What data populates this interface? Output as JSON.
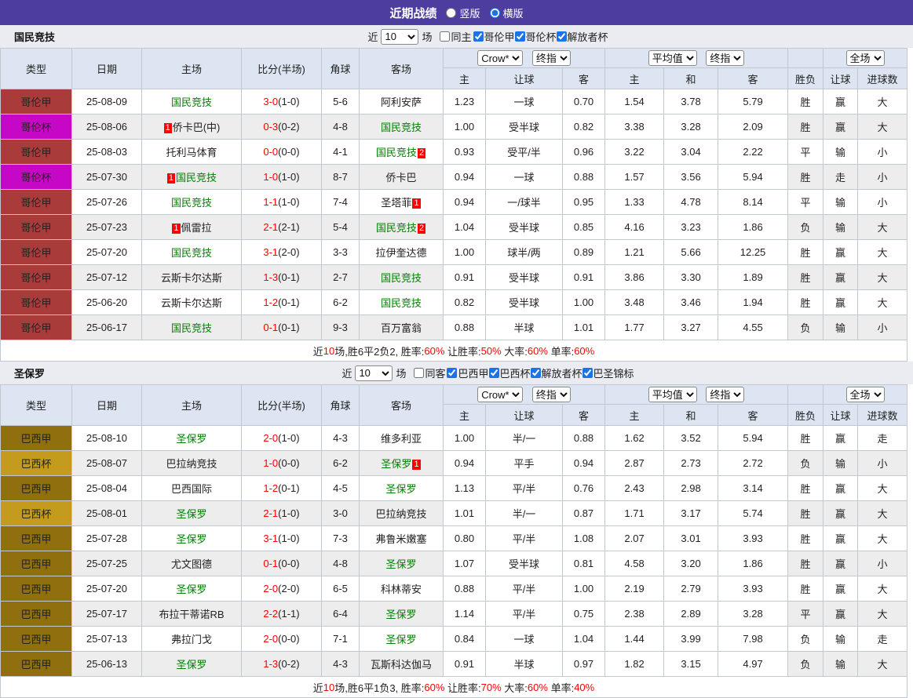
{
  "topbar": {
    "title": "近期战绩",
    "layout_options": [
      {
        "label": "竖版",
        "checked": false
      },
      {
        "label": "横版",
        "checked": true
      }
    ]
  },
  "league_colors": {
    "哥伦甲": "#A93B3B",
    "哥伦杯": "#C607C6",
    "巴西甲": "#8F6F0E",
    "巴西杯": "#C49B1D"
  },
  "result_colors": {
    "r": "#FF0000",
    "g": "#008000",
    "b": "#0011CC"
  },
  "table_headers": {
    "left": [
      "类型",
      "日期",
      "主场",
      "比分(半场)",
      "角球",
      "客场"
    ],
    "odds_sub": [
      "主",
      "让球",
      "客"
    ],
    "avg_sub": [
      "主",
      "和",
      "客"
    ],
    "right_sub": [
      "胜负",
      "让球",
      "进球数"
    ]
  },
  "sections": [
    {
      "team": "国民竞技",
      "filter": {
        "prefix": "近",
        "count": "10",
        "suffix": "场",
        "same": {
          "label": "同主",
          "checked": false
        },
        "leagues": [
          {
            "label": "哥伦甲",
            "checked": true
          },
          {
            "label": "哥伦杯",
            "checked": true
          },
          {
            "label": "解放者杯",
            "checked": true
          }
        ]
      },
      "selects": {
        "company": "Crow*",
        "final1": "终指",
        "average": "平均值",
        "final2": "终指",
        "scope": "全场"
      },
      "rows": [
        {
          "league": "哥伦甲",
          "date": "25-08-09",
          "home": {
            "name": "国民竞技",
            "focus": true
          },
          "score": "3-0",
          "half": "(1-0)",
          "corners": "5-6",
          "away": {
            "name": "阿利安萨"
          },
          "odds": [
            "1.23",
            "一球",
            "0.70"
          ],
          "avg": [
            "1.54",
            "3.78",
            "5.79"
          ],
          "results": [
            [
              "胜",
              "r"
            ],
            [
              "赢",
              "r"
            ],
            [
              "大",
              "r"
            ]
          ]
        },
        {
          "league": "哥伦杯",
          "date": "25-08-06",
          "home": {
            "badge_before": "1",
            "name": "侨卡巴(中)"
          },
          "score": "0-3",
          "half": "(0-2)",
          "corners": "4-8",
          "away": {
            "name": "国民竞技",
            "focus": true
          },
          "odds": [
            "1.00",
            "受半球",
            "0.82"
          ],
          "avg": [
            "3.38",
            "3.28",
            "2.09"
          ],
          "results": [
            [
              "胜",
              "r"
            ],
            [
              "赢",
              "r"
            ],
            [
              "大",
              "r"
            ]
          ]
        },
        {
          "league": "哥伦甲",
          "date": "25-08-03",
          "home": {
            "name": "托利马体育"
          },
          "score": "0-0",
          "half": "(0-0)",
          "corners": "4-1",
          "away": {
            "name": "国民竞技",
            "focus": true,
            "badge_after": "2"
          },
          "odds": [
            "0.93",
            "受平/半",
            "0.96"
          ],
          "avg": [
            "3.22",
            "3.04",
            "2.22"
          ],
          "results": [
            [
              "平",
              "g"
            ],
            [
              "输",
              "b"
            ],
            [
              "小",
              "b"
            ]
          ]
        },
        {
          "league": "哥伦杯",
          "date": "25-07-30",
          "home": {
            "badge_before": "1",
            "name": "国民竞技",
            "focus": true
          },
          "score": "1-0",
          "half": "(1-0)",
          "corners": "8-7",
          "away": {
            "name": "侨卡巴"
          },
          "odds": [
            "0.94",
            "一球",
            "0.88"
          ],
          "avg": [
            "1.57",
            "3.56",
            "5.94"
          ],
          "results": [
            [
              "胜",
              "r"
            ],
            [
              "走",
              "g"
            ],
            [
              "小",
              "b"
            ]
          ]
        },
        {
          "league": "哥伦甲",
          "date": "25-07-26",
          "home": {
            "name": "国民竞技",
            "focus": true
          },
          "score": "1-1",
          "half": "(1-0)",
          "corners": "7-4",
          "away": {
            "name": "圣塔菲",
            "badge_after": "1"
          },
          "odds": [
            "0.94",
            "一/球半",
            "0.95"
          ],
          "avg": [
            "1.33",
            "4.78",
            "8.14"
          ],
          "results": [
            [
              "平",
              "g"
            ],
            [
              "输",
              "b"
            ],
            [
              "小",
              "b"
            ]
          ]
        },
        {
          "league": "哥伦甲",
          "date": "25-07-23",
          "home": {
            "badge_before": "1",
            "name": "佩雷拉"
          },
          "score": "2-1",
          "half": "(2-1)",
          "corners": "5-4",
          "away": {
            "name": "国民竞技",
            "focus": true,
            "badge_after": "2"
          },
          "odds": [
            "1.04",
            "受半球",
            "0.85"
          ],
          "avg": [
            "4.16",
            "3.23",
            "1.86"
          ],
          "results": [
            [
              "负",
              "b"
            ],
            [
              "输",
              "b"
            ],
            [
              "大",
              "r"
            ]
          ]
        },
        {
          "league": "哥伦甲",
          "date": "25-07-20",
          "home": {
            "name": "国民竞技",
            "focus": true
          },
          "score": "3-1",
          "half": "(2-0)",
          "corners": "3-3",
          "away": {
            "name": "拉伊奎达德"
          },
          "odds": [
            "1.00",
            "球半/两",
            "0.89"
          ],
          "avg": [
            "1.21",
            "5.66",
            "12.25"
          ],
          "results": [
            [
              "胜",
              "r"
            ],
            [
              "赢",
              "r"
            ],
            [
              "大",
              "r"
            ]
          ]
        },
        {
          "league": "哥伦甲",
          "date": "25-07-12",
          "home": {
            "name": "云斯卡尔达斯"
          },
          "score": "1-3",
          "half": "(0-1)",
          "corners": "2-7",
          "away": {
            "name": "国民竞技",
            "focus": true
          },
          "odds": [
            "0.91",
            "受半球",
            "0.91"
          ],
          "avg": [
            "3.86",
            "3.30",
            "1.89"
          ],
          "results": [
            [
              "胜",
              "r"
            ],
            [
              "赢",
              "r"
            ],
            [
              "大",
              "r"
            ]
          ]
        },
        {
          "league": "哥伦甲",
          "date": "25-06-20",
          "home": {
            "name": "云斯卡尔达斯"
          },
          "score": "1-2",
          "half": "(0-1)",
          "corners": "6-2",
          "away": {
            "name": "国民竞技",
            "focus": true
          },
          "odds": [
            "0.82",
            "受半球",
            "1.00"
          ],
          "avg": [
            "3.48",
            "3.46",
            "1.94"
          ],
          "results": [
            [
              "胜",
              "r"
            ],
            [
              "赢",
              "r"
            ],
            [
              "大",
              "r"
            ]
          ]
        },
        {
          "league": "哥伦甲",
          "date": "25-06-17",
          "home": {
            "name": "国民竞技",
            "focus": true
          },
          "score": "0-1",
          "half": "(0-1)",
          "corners": "9-3",
          "away": {
            "name": "百万富翁"
          },
          "odds": [
            "0.88",
            "半球",
            "1.01"
          ],
          "avg": [
            "1.77",
            "3.27",
            "4.55"
          ],
          "results": [
            [
              "负",
              "b"
            ],
            [
              "输",
              "b"
            ],
            [
              "小",
              "b"
            ]
          ]
        }
      ],
      "summary": [
        [
          "近",
          "k"
        ],
        [
          "10",
          "r"
        ],
        [
          "场,胜6平2负2, 胜率:",
          "k"
        ],
        [
          "60%",
          "r"
        ],
        [
          " 让胜率:",
          "k"
        ],
        [
          "50%",
          "r"
        ],
        [
          " 大率:",
          "k"
        ],
        [
          "60%",
          "r"
        ],
        [
          " 单率:",
          "k"
        ],
        [
          "60%",
          "r"
        ]
      ]
    },
    {
      "team": "圣保罗",
      "filter": {
        "prefix": "近",
        "count": "10",
        "suffix": "场",
        "same": {
          "label": "同客",
          "checked": false
        },
        "leagues": [
          {
            "label": "巴西甲",
            "checked": true
          },
          {
            "label": "巴西杯",
            "checked": true
          },
          {
            "label": "解放者杯",
            "checked": true
          },
          {
            "label": "巴圣锦标",
            "checked": true
          }
        ]
      },
      "selects": {
        "company": "Crow*",
        "final1": "终指",
        "average": "平均值",
        "final2": "终指",
        "scope": "全场"
      },
      "rows": [
        {
          "league": "巴西甲",
          "date": "25-08-10",
          "home": {
            "name": "圣保罗",
            "focus": true
          },
          "score": "2-0",
          "half": "(1-0)",
          "corners": "4-3",
          "away": {
            "name": "维多利亚"
          },
          "odds": [
            "1.00",
            "半/一",
            "0.88"
          ],
          "avg": [
            "1.62",
            "3.52",
            "5.94"
          ],
          "results": [
            [
              "胜",
              "r"
            ],
            [
              "赢",
              "r"
            ],
            [
              "走",
              "g"
            ]
          ]
        },
        {
          "league": "巴西杯",
          "date": "25-08-07",
          "home": {
            "name": "巴拉纳竞技"
          },
          "score": "1-0",
          "half": "(0-0)",
          "corners": "6-2",
          "away": {
            "name": "圣保罗",
            "focus": true,
            "badge_after": "1"
          },
          "odds": [
            "0.94",
            "平手",
            "0.94"
          ],
          "avg": [
            "2.87",
            "2.73",
            "2.72"
          ],
          "results": [
            [
              "负",
              "b"
            ],
            [
              "输",
              "b"
            ],
            [
              "小",
              "b"
            ]
          ]
        },
        {
          "league": "巴西甲",
          "date": "25-08-04",
          "home": {
            "name": "巴西国际"
          },
          "score": "1-2",
          "half": "(0-1)",
          "corners": "4-5",
          "away": {
            "name": "圣保罗",
            "focus": true
          },
          "odds": [
            "1.13",
            "平/半",
            "0.76"
          ],
          "avg": [
            "2.43",
            "2.98",
            "3.14"
          ],
          "results": [
            [
              "胜",
              "r"
            ],
            [
              "赢",
              "r"
            ],
            [
              "大",
              "r"
            ]
          ]
        },
        {
          "league": "巴西杯",
          "date": "25-08-01",
          "home": {
            "name": "圣保罗",
            "focus": true
          },
          "score": "2-1",
          "half": "(1-0)",
          "corners": "3-0",
          "away": {
            "name": "巴拉纳竞技"
          },
          "odds": [
            "1.01",
            "半/一",
            "0.87"
          ],
          "avg": [
            "1.71",
            "3.17",
            "5.74"
          ],
          "results": [
            [
              "胜",
              "r"
            ],
            [
              "赢",
              "r"
            ],
            [
              "大",
              "r"
            ]
          ]
        },
        {
          "league": "巴西甲",
          "date": "25-07-28",
          "home": {
            "name": "圣保罗",
            "focus": true
          },
          "score": "3-1",
          "half": "(1-0)",
          "corners": "7-3",
          "away": {
            "name": "弗鲁米嫩塞"
          },
          "odds": [
            "0.80",
            "平/半",
            "1.08"
          ],
          "avg": [
            "2.07",
            "3.01",
            "3.93"
          ],
          "results": [
            [
              "胜",
              "r"
            ],
            [
              "赢",
              "r"
            ],
            [
              "大",
              "r"
            ]
          ]
        },
        {
          "league": "巴西甲",
          "date": "25-07-25",
          "home": {
            "name": "尤文图德"
          },
          "score": "0-1",
          "half": "(0-0)",
          "corners": "4-8",
          "away": {
            "name": "圣保罗",
            "focus": true
          },
          "odds": [
            "1.07",
            "受半球",
            "0.81"
          ],
          "avg": [
            "4.58",
            "3.20",
            "1.86"
          ],
          "results": [
            [
              "胜",
              "r"
            ],
            [
              "赢",
              "r"
            ],
            [
              "小",
              "b"
            ]
          ]
        },
        {
          "league": "巴西甲",
          "date": "25-07-20",
          "home": {
            "name": "圣保罗",
            "focus": true
          },
          "score": "2-0",
          "half": "(2-0)",
          "corners": "6-5",
          "away": {
            "name": "科林蒂安"
          },
          "odds": [
            "0.88",
            "平/半",
            "1.00"
          ],
          "avg": [
            "2.19",
            "2.79",
            "3.93"
          ],
          "results": [
            [
              "胜",
              "r"
            ],
            [
              "赢",
              "r"
            ],
            [
              "大",
              "r"
            ]
          ]
        },
        {
          "league": "巴西甲",
          "date": "25-07-17",
          "home": {
            "name": "布拉干蒂诺RB"
          },
          "score": "2-2",
          "half": "(1-1)",
          "corners": "6-4",
          "away": {
            "name": "圣保罗",
            "focus": true
          },
          "odds": [
            "1.14",
            "平/半",
            "0.75"
          ],
          "avg": [
            "2.38",
            "2.89",
            "3.28"
          ],
          "results": [
            [
              "平",
              "g"
            ],
            [
              "赢",
              "r"
            ],
            [
              "大",
              "r"
            ]
          ]
        },
        {
          "league": "巴西甲",
          "date": "25-07-13",
          "home": {
            "name": "弗拉门戈"
          },
          "score": "2-0",
          "half": "(0-0)",
          "corners": "7-1",
          "away": {
            "name": "圣保罗",
            "focus": true
          },
          "odds": [
            "0.84",
            "一球",
            "1.04"
          ],
          "avg": [
            "1.44",
            "3.99",
            "7.98"
          ],
          "results": [
            [
              "负",
              "b"
            ],
            [
              "输",
              "b"
            ],
            [
              "走",
              "g"
            ]
          ]
        },
        {
          "league": "巴西甲",
          "date": "25-06-13",
          "home": {
            "name": "圣保罗",
            "focus": true
          },
          "score": "1-3",
          "half": "(0-2)",
          "corners": "4-3",
          "away": {
            "name": "瓦斯科达伽马"
          },
          "odds": [
            "0.91",
            "半球",
            "0.97"
          ],
          "avg": [
            "1.82",
            "3.15",
            "4.97"
          ],
          "results": [
            [
              "负",
              "b"
            ],
            [
              "输",
              "b"
            ],
            [
              "大",
              "r"
            ]
          ]
        }
      ],
      "summary": [
        [
          "近",
          "k"
        ],
        [
          "10",
          "r"
        ],
        [
          "场,胜6平1负3, 胜率:",
          "k"
        ],
        [
          "60%",
          "r"
        ],
        [
          " 让胜率:",
          "k"
        ],
        [
          "70%",
          "r"
        ],
        [
          " 大率:",
          "k"
        ],
        [
          "60%",
          "r"
        ],
        [
          " 单率:",
          "k"
        ],
        [
          "40%",
          "r"
        ]
      ]
    }
  ]
}
